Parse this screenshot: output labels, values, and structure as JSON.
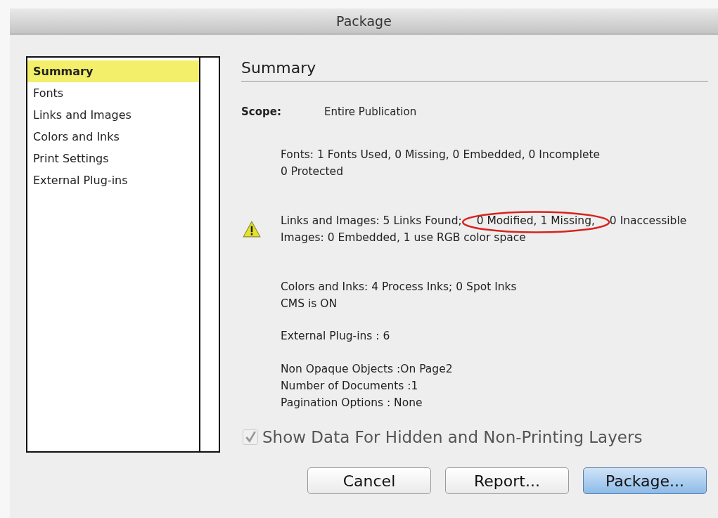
{
  "window": {
    "title": "Package"
  },
  "sidebar": {
    "items": [
      {
        "label": "Summary",
        "selected": true
      },
      {
        "label": "Fonts",
        "selected": false
      },
      {
        "label": "Links and Images",
        "selected": false
      },
      {
        "label": "Colors and Inks",
        "selected": false
      },
      {
        "label": "Print Settings",
        "selected": false
      },
      {
        "label": "External Plug-ins",
        "selected": false
      }
    ]
  },
  "panel": {
    "heading": "Summary",
    "scope": {
      "label": "Scope:",
      "value": "Entire Publication"
    },
    "sections": [
      {
        "warning": false,
        "lines": [
          "Fonts: 1 Fonts Used, 0 Missing, 0 Embedded, 0 Incomplete",
          "0 Protected"
        ]
      },
      {
        "warning": true,
        "lines": [
          [
            {
              "text": "Links and Images: 5 Links Found; ",
              "circled": false
            },
            {
              "text": "0 Modified, 1 Missing,",
              "circled": true
            },
            {
              "text": " 0 Inaccessible",
              "circled": false
            }
          ],
          "Images: 0 Embedded, 1 use RGB color space"
        ]
      },
      {
        "warning": false,
        "lines": [
          "Colors and Inks: 4 Process Inks; 0 Spot Inks",
          "CMS is ON"
        ]
      },
      {
        "warning": false,
        "lines": [
          "External Plug-ins : 6"
        ]
      },
      {
        "warning": false,
        "lines": [
          "Non Opaque Objects :On Page2",
          "Number of Documents :1",
          "Pagination Options : None"
        ]
      }
    ]
  },
  "checkbox": {
    "label": "Show Data For Hidden and Non-Printing Layers",
    "checked": true,
    "disabled": true
  },
  "buttons": [
    {
      "label": "Cancel",
      "default": false
    },
    {
      "label": "Report...",
      "default": false
    },
    {
      "label": "Package...",
      "default": true
    }
  ]
}
